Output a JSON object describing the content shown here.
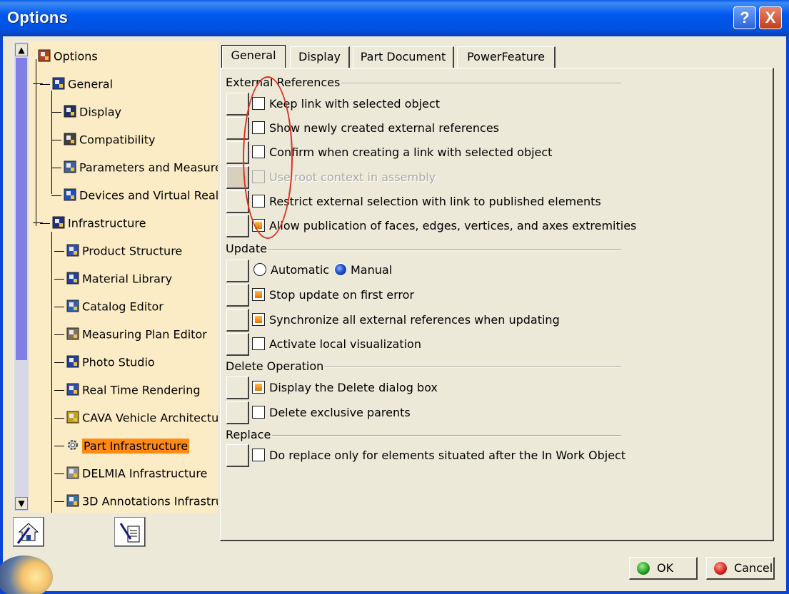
{
  "window": {
    "title": "Options"
  },
  "titlebar_buttons": {
    "help": "?",
    "close": "X"
  },
  "tree": {
    "scroll_up": "▲",
    "scroll_down": "▼",
    "items": [
      {
        "label": "Options",
        "icon": "options-icon"
      },
      {
        "label": "General",
        "icon": "general-icon"
      },
      {
        "label": "Display",
        "icon": "display-icon"
      },
      {
        "label": "Compatibility",
        "icon": "compatibility-icon"
      },
      {
        "label": "Parameters and Measure",
        "icon": "parameters-icon"
      },
      {
        "label": "Devices and Virtual Realit",
        "icon": "devices-icon"
      },
      {
        "label": "Infrastructure",
        "icon": "infrastructure-icon"
      },
      {
        "label": "Product Structure",
        "icon": "product-structure-icon"
      },
      {
        "label": "Material Library",
        "icon": "material-library-icon"
      },
      {
        "label": "Catalog Editor",
        "icon": "catalog-editor-icon"
      },
      {
        "label": "Measuring Plan Editor",
        "icon": "measuring-plan-icon"
      },
      {
        "label": "Photo Studio",
        "icon": "photo-studio-icon"
      },
      {
        "label": "Real Time Rendering",
        "icon": "real-time-rendering-icon"
      },
      {
        "label": "CAVA Vehicle Architectur",
        "icon": "cava-icon"
      },
      {
        "label": "Part Infrastructure",
        "icon": "gear-icon",
        "selected": true
      },
      {
        "label": "DELMIA Infrastructure",
        "icon": "delmia-icon"
      },
      {
        "label": "3D Annotations Infrastru",
        "icon": "annotations-icon"
      }
    ]
  },
  "tabs": [
    "General",
    "Display",
    "Part Document",
    "PowerFeature"
  ],
  "active_tab": "General",
  "sections": {
    "external_references": {
      "title": "External References",
      "options": [
        {
          "label": "Keep link with selected object",
          "checked": false
        },
        {
          "label": "Show newly created external references",
          "checked": false
        },
        {
          "label": "Confirm when creating a link with selected object",
          "checked": false
        },
        {
          "label": "Use root context in assembly",
          "checked": false,
          "disabled": true
        },
        {
          "label": "Restrict external selection with link to published elements",
          "checked": false
        },
        {
          "label": "Allow publication of faces, edges, vertices, and axes extremities",
          "checked": true
        }
      ]
    },
    "update": {
      "title": "Update",
      "radio_automatic": "Automatic",
      "radio_manual": "Manual",
      "selected": "Manual",
      "options": [
        {
          "label": "Stop update on first error",
          "checked": true
        },
        {
          "label": "Synchronize all external references when updating",
          "checked": true
        },
        {
          "label": "Activate local visualization",
          "checked": false
        }
      ]
    },
    "delete_operation": {
      "title": "Delete Operation",
      "options": [
        {
          "label": "Display the Delete dialog box",
          "checked": true
        },
        {
          "label": "Delete exclusive parents",
          "checked": false
        }
      ]
    },
    "replace": {
      "title": "Replace",
      "options": [
        {
          "label": "Do replace only for elements situated after the In Work Object",
          "checked": false
        }
      ]
    }
  },
  "buttons": {
    "ok": "OK",
    "cancel": "Cancel"
  },
  "colors": {
    "selected_highlight": "#FF8A14",
    "tree_background": "#FCECC5",
    "annotation": "#E03020"
  }
}
